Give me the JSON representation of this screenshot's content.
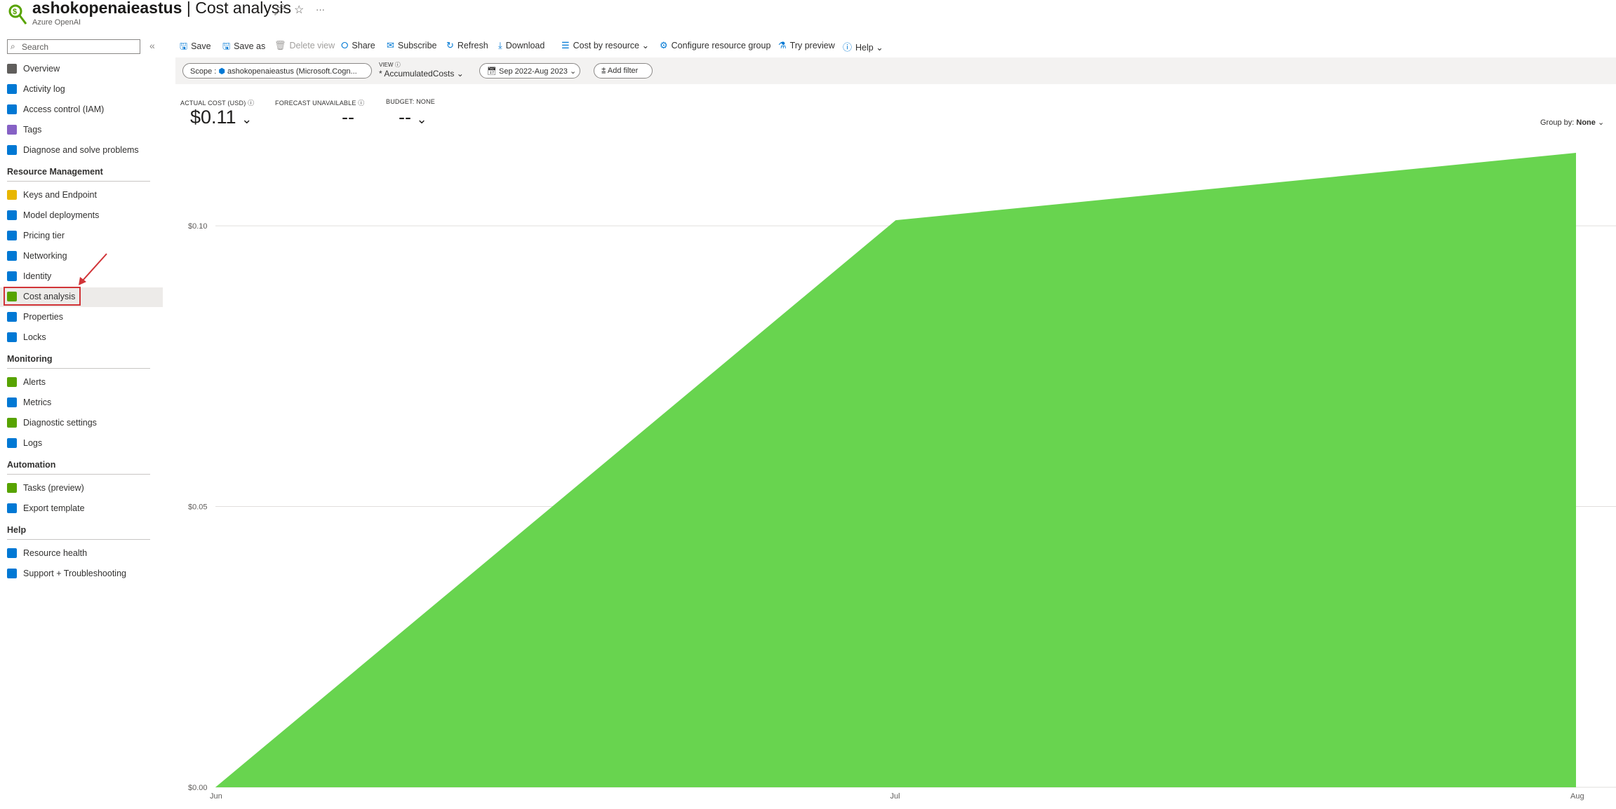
{
  "header": {
    "resource_name": "ashokopenaieastus",
    "separator": " | ",
    "page_name": "Cost analysis",
    "subtitle": "Azure OpenAI",
    "more": "···"
  },
  "sidebar": {
    "search_placeholder": "Search",
    "collapse": "«",
    "items_top": [
      {
        "label": "Overview",
        "icon": "overview-icon",
        "color": "#605e5c"
      },
      {
        "label": "Activity log",
        "icon": "activity-log-icon",
        "color": "#0078d4"
      },
      {
        "label": "Access control (IAM)",
        "icon": "access-control-icon",
        "color": "#0078d4"
      },
      {
        "label": "Tags",
        "icon": "tag-icon",
        "color": "#8661c5"
      },
      {
        "label": "Diagnose and solve problems",
        "icon": "diagnose-icon",
        "color": "#0078d4"
      }
    ],
    "sections": [
      {
        "title": "Resource Management",
        "items": [
          {
            "label": "Keys and Endpoint",
            "icon": "key-icon",
            "color": "#e8b600"
          },
          {
            "label": "Model deployments",
            "icon": "cube-icon",
            "color": "#0078d4"
          },
          {
            "label": "Pricing tier",
            "icon": "pricing-icon",
            "color": "#0078d4"
          },
          {
            "label": "Networking",
            "icon": "networking-icon",
            "color": "#0078d4"
          },
          {
            "label": "Identity",
            "icon": "identity-icon",
            "color": "#0078d4"
          },
          {
            "label": "Cost analysis",
            "icon": "cost-analysis-icon",
            "color": "#57a300",
            "selected": true
          },
          {
            "label": "Properties",
            "icon": "properties-icon",
            "color": "#0078d4"
          },
          {
            "label": "Locks",
            "icon": "lock-icon",
            "color": "#0078d4"
          }
        ]
      },
      {
        "title": "Monitoring",
        "items": [
          {
            "label": "Alerts",
            "icon": "alert-icon",
            "color": "#57a300"
          },
          {
            "label": "Metrics",
            "icon": "metrics-icon",
            "color": "#0078d4"
          },
          {
            "label": "Diagnostic settings",
            "icon": "diagnostic-settings-icon",
            "color": "#57a300"
          },
          {
            "label": "Logs",
            "icon": "logs-icon",
            "color": "#0078d4"
          }
        ]
      },
      {
        "title": "Automation",
        "items": [
          {
            "label": "Tasks (preview)",
            "icon": "tasks-icon",
            "color": "#57a300"
          },
          {
            "label": "Export template",
            "icon": "export-template-icon",
            "color": "#0078d4"
          }
        ]
      },
      {
        "title": "Help",
        "items": [
          {
            "label": "Resource health",
            "icon": "resource-health-icon",
            "color": "#0078d4"
          },
          {
            "label": "Support + Troubleshooting",
            "icon": "support-icon",
            "color": "#0078d4"
          }
        ]
      }
    ]
  },
  "toolbar": {
    "save": "Save",
    "save_as": "Save as",
    "delete_view": "Delete view",
    "share": "Share",
    "subscribe": "Subscribe",
    "refresh": "Refresh",
    "download": "Download",
    "cost_by_resource": "Cost by resource",
    "configure_rg": "Configure resource group",
    "try_preview": "Try preview",
    "help": "Help"
  },
  "filters": {
    "scope_label": "Scope :",
    "scope_value": "ashokopenaieastus (Microsoft.Cogn...",
    "view_label": "VIEW",
    "view_value": "* AccumulatedCosts",
    "date_range": "Sep 2022-Aug 2023",
    "add_filter": "Add filter"
  },
  "kpis": {
    "actual_label": "ACTUAL COST (USD)",
    "actual_value": "$0.11",
    "forecast_label": "FORECAST UNAVAILABLE",
    "forecast_value": "--",
    "budget_label": "BUDGET: NONE",
    "budget_value": "--"
  },
  "group_by": {
    "label": "Group by:",
    "value": "None"
  },
  "chart_data": {
    "type": "area",
    "x": [
      "Jun",
      "Jul",
      "Aug"
    ],
    "values": [
      0.0,
      0.101,
      0.113
    ],
    "ylim": [
      0,
      0.114
    ],
    "yticks": [
      0.0,
      0.05,
      0.1
    ],
    "ytick_labels": [
      "$0.00",
      "$0.05",
      "$0.10"
    ],
    "color": "#68d44f",
    "grid": true
  }
}
